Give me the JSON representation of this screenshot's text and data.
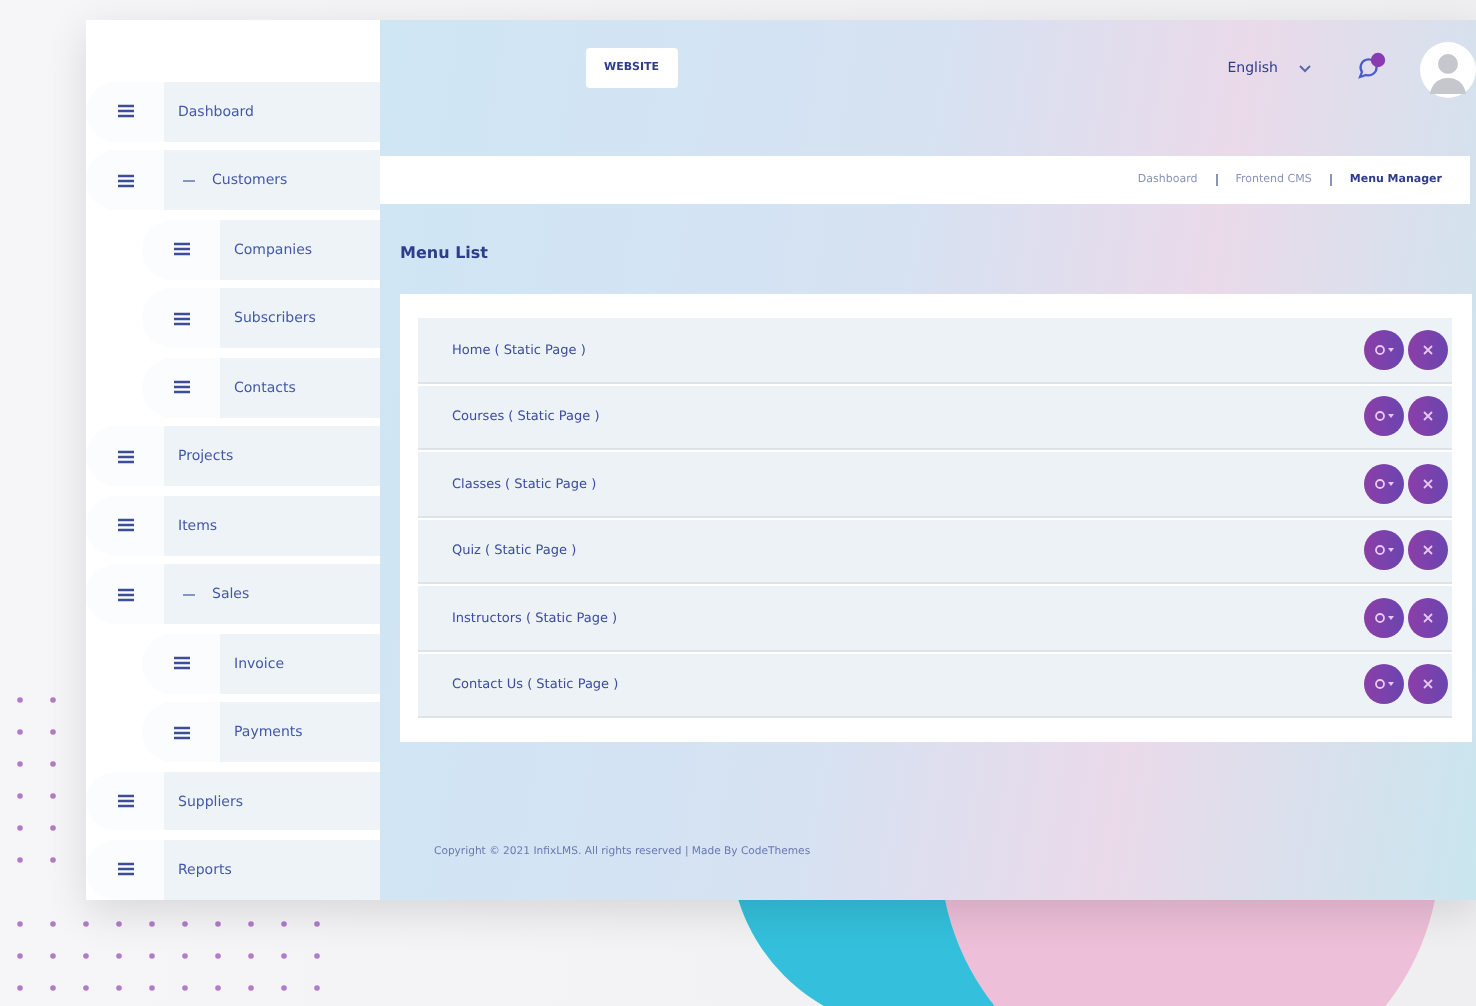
{
  "header": {
    "website_button": "WEBSITE",
    "language": "English"
  },
  "sidebar": {
    "items": [
      {
        "label": "Dashboard"
      },
      {
        "label": "Customers",
        "expanded": true,
        "children": [
          {
            "label": "Companies"
          },
          {
            "label": "Subscribers"
          },
          {
            "label": "Contacts"
          }
        ]
      },
      {
        "label": "Projects"
      },
      {
        "label": "Items"
      },
      {
        "label": "Sales",
        "expanded": true,
        "children": [
          {
            "label": "Invoice"
          },
          {
            "label": "Payments"
          }
        ]
      },
      {
        "label": "Suppliers"
      },
      {
        "label": "Reports"
      }
    ]
  },
  "breadcrumb": [
    {
      "label": "Dashboard",
      "selected": false
    },
    {
      "label": "Frontend CMS",
      "selected": false
    },
    {
      "label": "Menu Manager",
      "selected": true
    }
  ],
  "page_title": "Menu List",
  "menu_items": [
    {
      "label": "Home ( Static Page )"
    },
    {
      "label": "Courses ( Static Page )"
    },
    {
      "label": "Classes ( Static Page )"
    },
    {
      "label": "Quiz ( Static Page )"
    },
    {
      "label": "Instructors ( Static Page )"
    },
    {
      "label": "Contact Us ( Static Page )"
    }
  ],
  "footer": "Copyright © 2021 InfixLMS. All rights reserved | Made By CodeThemes"
}
